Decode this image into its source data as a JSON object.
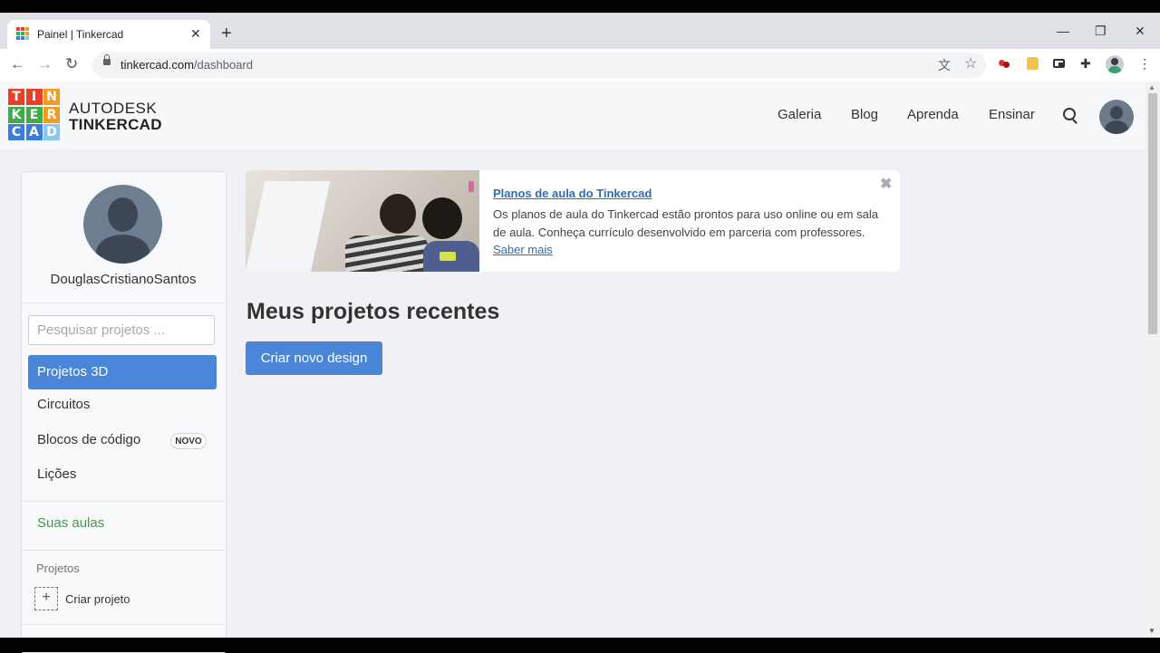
{
  "browser": {
    "tab_title": "Painel | Tinkercad",
    "tab_close": "✕",
    "new_tab": "+",
    "url_host": "tinkercad.com",
    "url_path": "/dashboard",
    "nav_back": "←",
    "nav_forward": "→",
    "nav_reload": "↻",
    "win_minimize": "—",
    "win_restore": "❐",
    "win_close": "✕",
    "icon_translate": "文",
    "icon_star": "☆",
    "icon_extensions": "✚",
    "icon_menu": "⋮"
  },
  "header": {
    "logo_letters": [
      "T",
      "I",
      "N",
      "K",
      "E",
      "R",
      "C",
      "A",
      "D"
    ],
    "logo_colors": [
      "#e8412b",
      "#e8412b",
      "#f29c1f",
      "#3fae49",
      "#3fae49",
      "#f29c1f",
      "#3c7dd9",
      "#3c7dd9",
      "#8bc7ec"
    ],
    "brand_top": "AUTODESK",
    "brand_bottom": "TINKERCAD",
    "nav": [
      "Galeria",
      "Blog",
      "Aprenda",
      "Ensinar"
    ]
  },
  "sidebar": {
    "username": "DouglasCristianoSantos",
    "search_placeholder": "Pesquisar projetos ...",
    "items": [
      {
        "label": "Projetos 3D",
        "active": true
      },
      {
        "label": "Circuitos"
      },
      {
        "label": "Blocos de código",
        "badge": "NOVO"
      },
      {
        "label": "Lições"
      }
    ],
    "classes_label": "Suas aulas",
    "projects_label": "Projetos",
    "create_project_plus": "+",
    "create_project_label": "Criar projeto"
  },
  "banner": {
    "title": "Planos de aula do Tinkercad",
    "text": "Os planos de aula do Tinkercad estão prontos para uso online ou em sala de aula. Conheça currículo desenvolvido em parceria com professores. ",
    "link": "Saber mais",
    "close": "✖"
  },
  "main": {
    "recent_title": "Meus projetos recentes",
    "create_button": "Criar novo design"
  },
  "colors": {
    "accent_blue": "#4a86d7",
    "green": "#3a9e4a"
  }
}
